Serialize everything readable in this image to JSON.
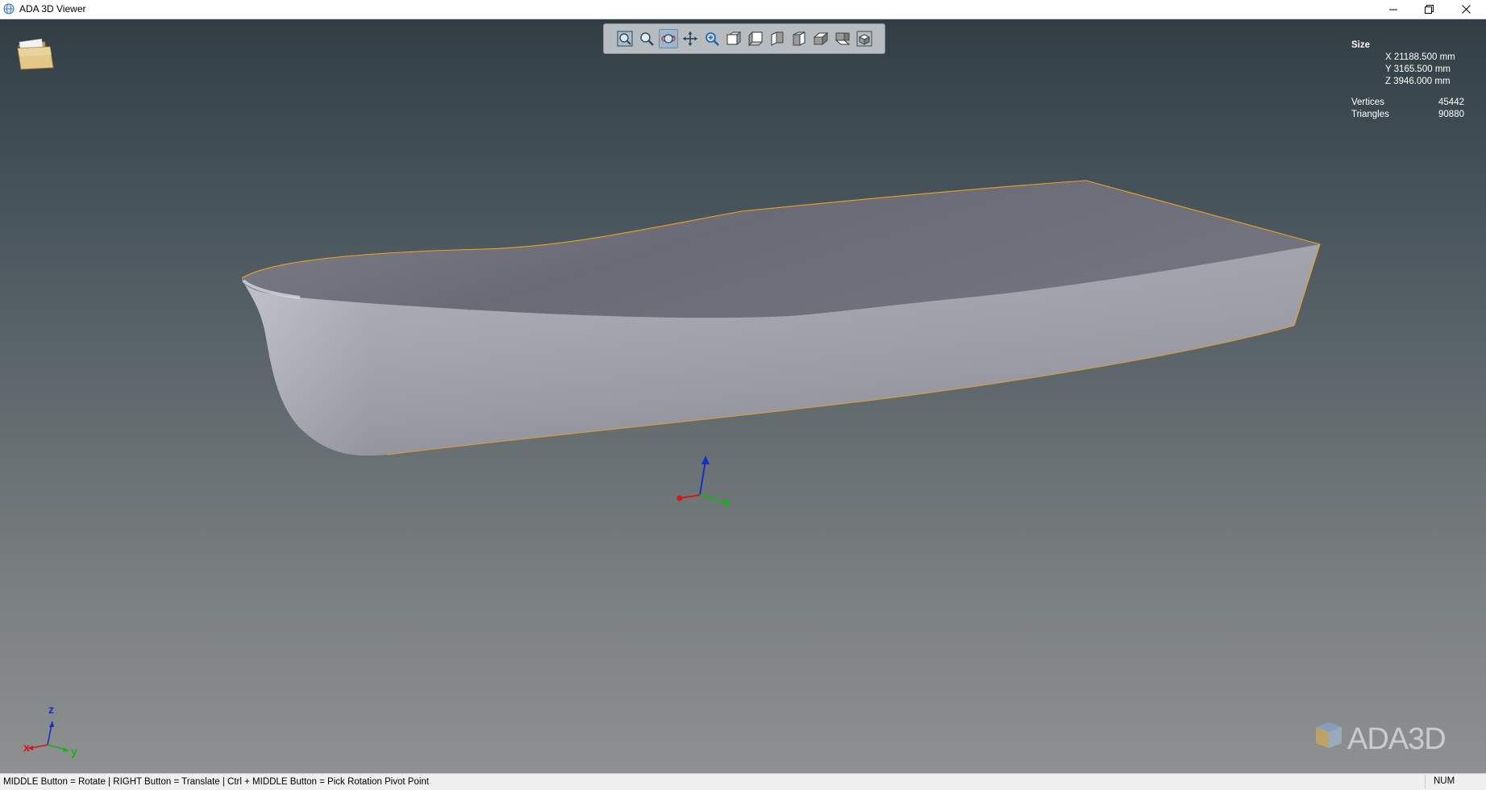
{
  "window": {
    "title": "ADA 3D Viewer",
    "controls": [
      "minimize-icon",
      "restore-icon",
      "close-icon"
    ]
  },
  "toolbar": {
    "buttons": [
      {
        "name": "zoom-extents",
        "icon": "zoom-fit-icon"
      },
      {
        "name": "zoom-window",
        "icon": "zoom-window-icon"
      },
      {
        "name": "rotate",
        "icon": "rotate-icon",
        "active": true
      },
      {
        "name": "pan",
        "icon": "pan-icon"
      },
      {
        "name": "zoom",
        "icon": "zoom-icon"
      },
      {
        "name": "view-front",
        "icon": "cube-front-icon"
      },
      {
        "name": "view-back",
        "icon": "cube-back-icon"
      },
      {
        "name": "view-left",
        "icon": "cube-left-icon"
      },
      {
        "name": "view-right",
        "icon": "cube-right-icon"
      },
      {
        "name": "view-top",
        "icon": "cube-top-icon"
      },
      {
        "name": "view-bottom",
        "icon": "cube-bottom-icon"
      },
      {
        "name": "view-iso",
        "icon": "cube-iso-icon"
      }
    ]
  },
  "info": {
    "size_title": "Size",
    "x": "X  21188.500 mm",
    "y": "Y    3165.500 mm",
    "z": "Z    3946.000 mm",
    "vertices_label": "Vertices",
    "vertices_value": "45442",
    "triangles_label": "Triangles",
    "triangles_value": "90880"
  },
  "axis": {
    "x": "x",
    "y": "y",
    "z": "z"
  },
  "logo": {
    "text": "ADA3D"
  },
  "status": {
    "hint": "MIDDLE Button = Rotate | RIGHT Button = Translate | Ctrl + MIDDLE Button = Pick Rotation Pivot Point",
    "num": "NUM"
  },
  "colors": {
    "edge_highlight": "#f0a020",
    "axis_x": "#d01818",
    "axis_y": "#1ab01a",
    "axis_z": "#1530c0"
  }
}
